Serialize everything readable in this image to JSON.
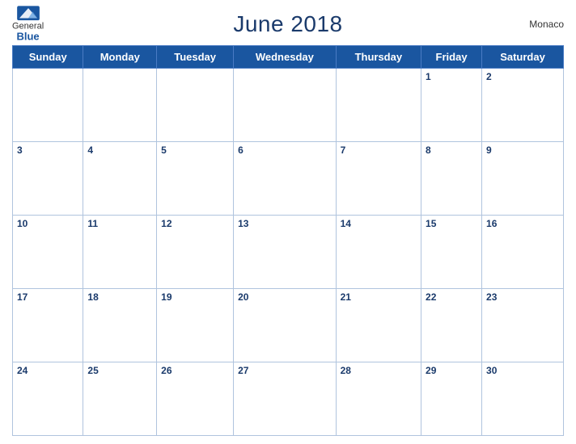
{
  "header": {
    "title": "June 2018",
    "country": "Monaco",
    "logo_general": "General",
    "logo_blue": "Blue"
  },
  "weekdays": [
    "Sunday",
    "Monday",
    "Tuesday",
    "Wednesday",
    "Thursday",
    "Friday",
    "Saturday"
  ],
  "weeks": [
    [
      null,
      null,
      null,
      null,
      null,
      1,
      2
    ],
    [
      3,
      4,
      5,
      6,
      7,
      8,
      9
    ],
    [
      10,
      11,
      12,
      13,
      14,
      15,
      16
    ],
    [
      17,
      18,
      19,
      20,
      21,
      22,
      23
    ],
    [
      24,
      25,
      26,
      27,
      28,
      29,
      30
    ]
  ]
}
